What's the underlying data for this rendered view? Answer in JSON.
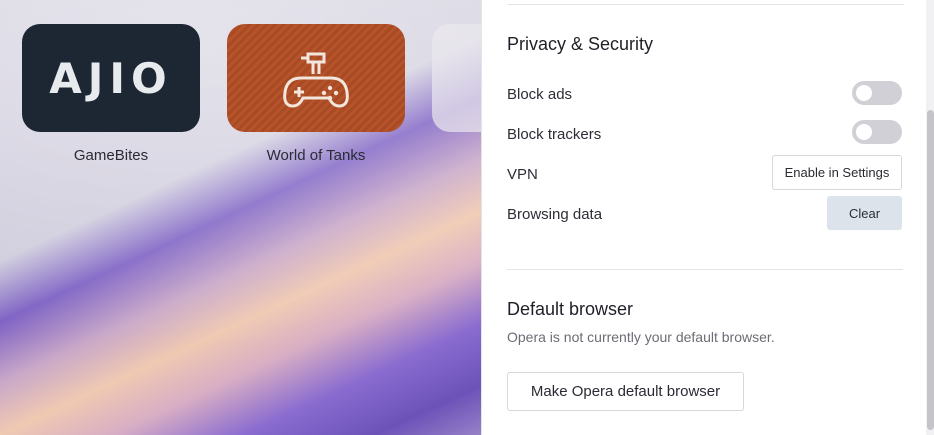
{
  "speed_dial": {
    "tiles": [
      {
        "label": "GameBites",
        "logo_text": "AJIO",
        "icon": "ajio-logo"
      },
      {
        "label": "World of Tanks",
        "icon": "gamepad-icon"
      }
    ]
  },
  "settings": {
    "privacy": {
      "title": "Privacy & Security",
      "block_ads": {
        "label": "Block ads",
        "enabled": false
      },
      "block_trackers": {
        "label": "Block trackers",
        "enabled": false
      },
      "vpn": {
        "label": "VPN",
        "button": "Enable in Settings"
      },
      "browsing_data": {
        "label": "Browsing data",
        "button": "Clear"
      }
    },
    "default_browser": {
      "title": "Default browser",
      "description": "Opera is not currently your default browser.",
      "button": "Make Opera default browser"
    }
  },
  "colors": {
    "panel_bg": "#ffffff",
    "toggle_off": "#d0d0d6",
    "clear_button": "#dde3ea",
    "ajio_tile": "#1d2733",
    "wot_tile": "#b5532a"
  }
}
